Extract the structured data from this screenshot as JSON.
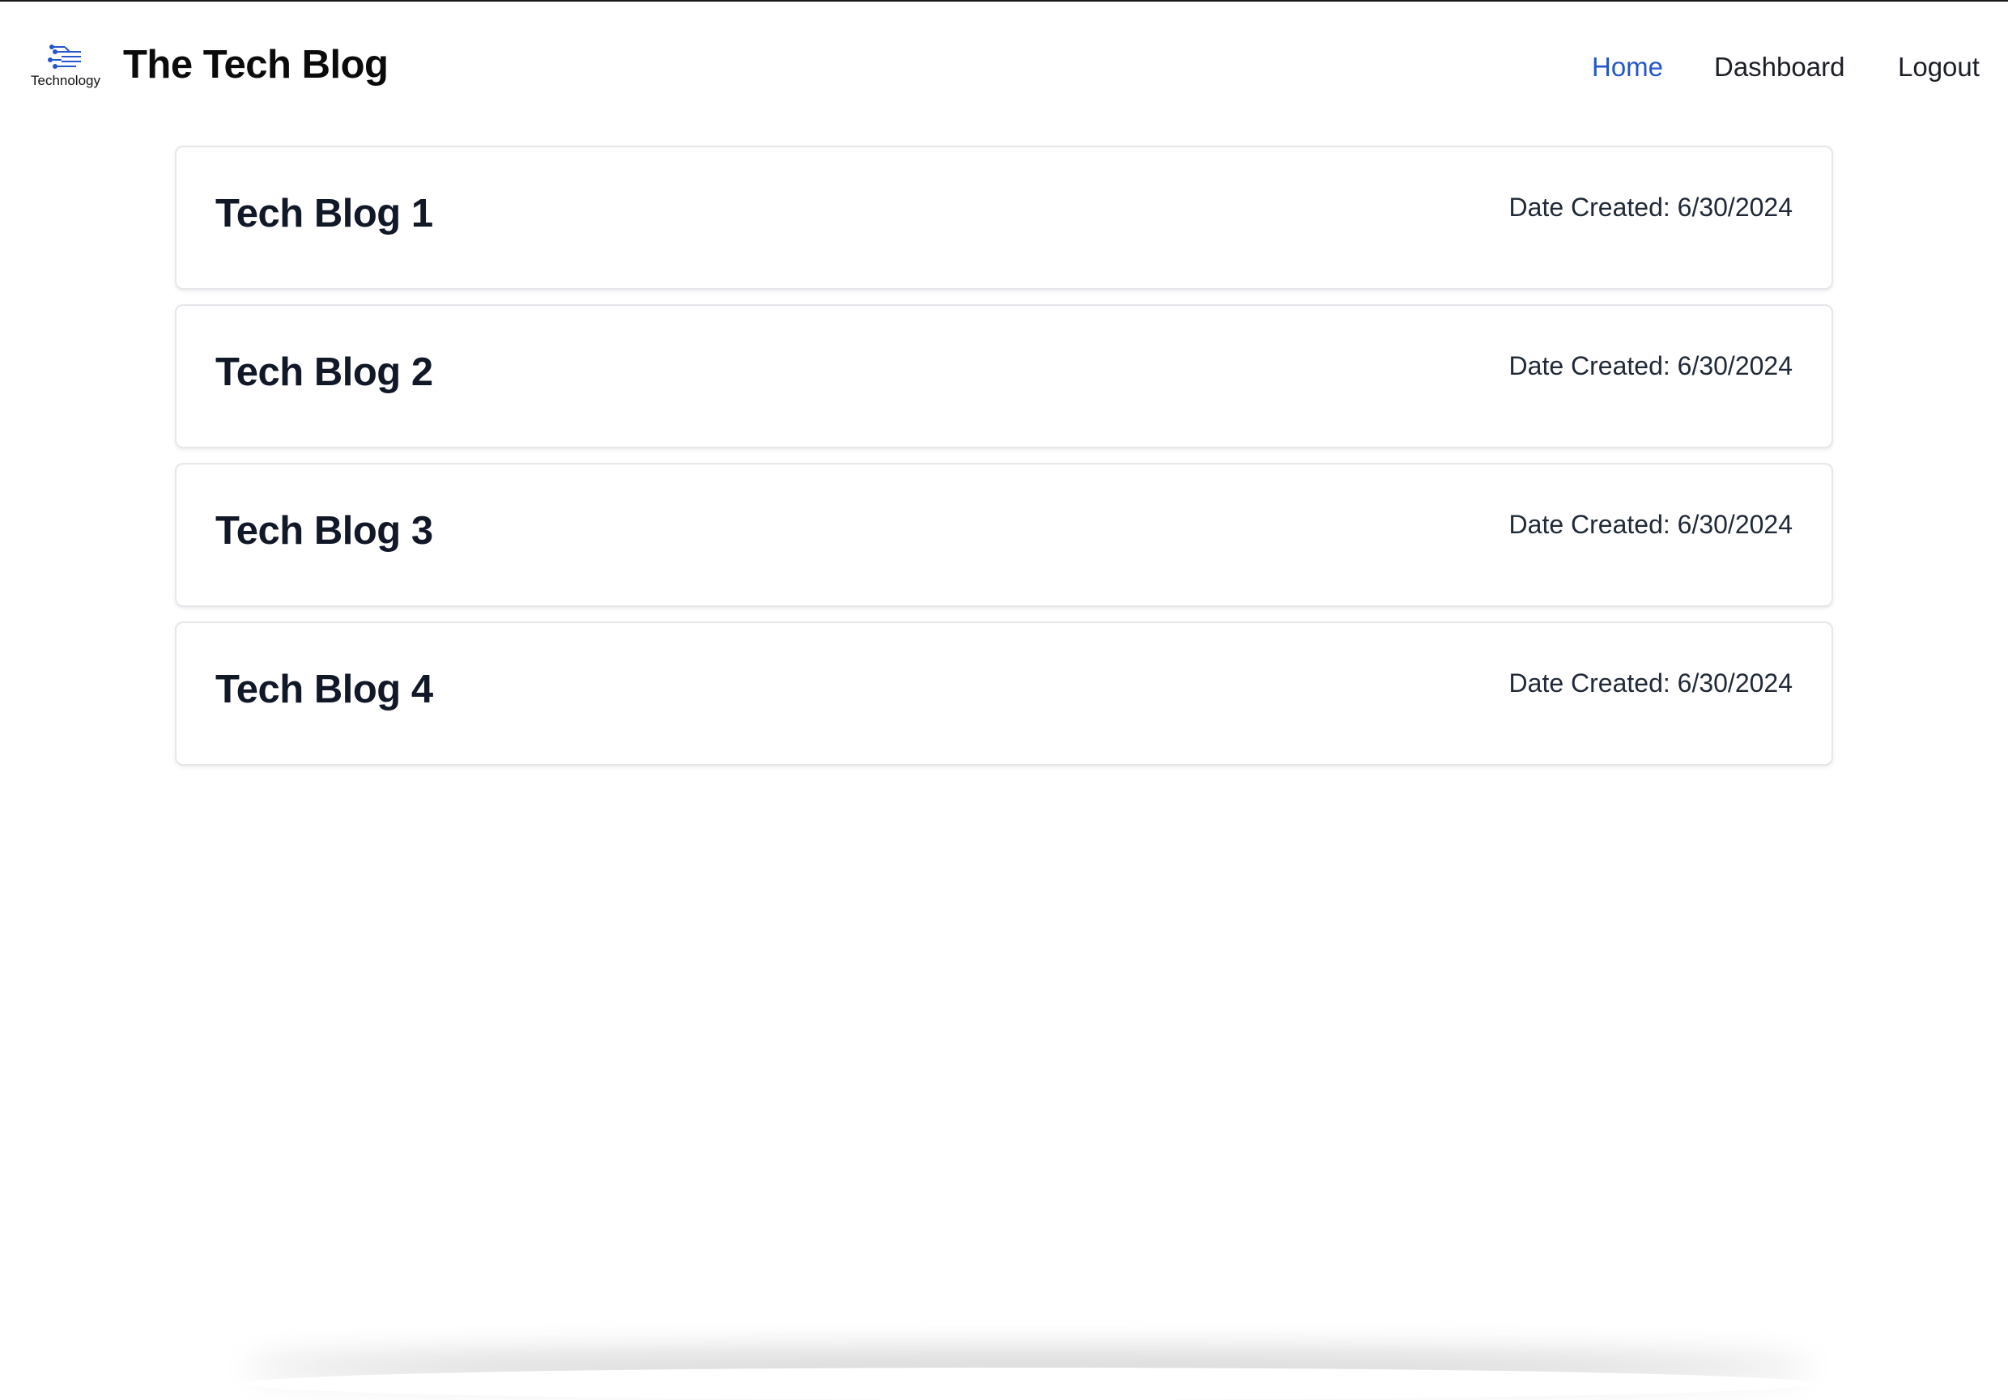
{
  "header": {
    "logo_text": "Technology",
    "site_title": "The Tech Blog",
    "nav": {
      "home": "Home",
      "dashboard": "Dashboard",
      "logout": "Logout"
    },
    "active_color": "#2457c9"
  },
  "posts": [
    {
      "title": "Tech Blog 1",
      "date": "Date Created: 6/30/2024"
    },
    {
      "title": "Tech Blog 2",
      "date": "Date Created: 6/30/2024"
    },
    {
      "title": "Tech Blog 3",
      "date": "Date Created: 6/30/2024"
    },
    {
      "title": "Tech Blog 4",
      "date": "Date Created: 6/30/2024"
    }
  ]
}
